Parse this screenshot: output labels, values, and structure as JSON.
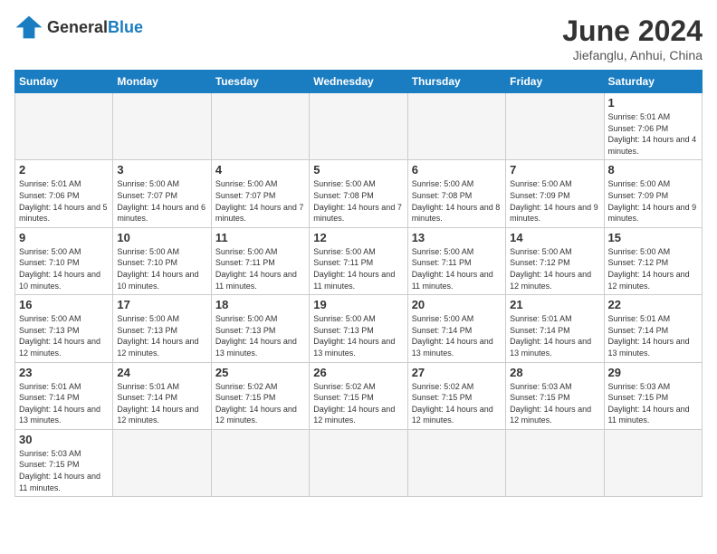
{
  "header": {
    "logo_general": "General",
    "logo_blue": "Blue",
    "month": "June 2024",
    "location": "Jiefanglu, Anhui, China"
  },
  "days_of_week": [
    "Sunday",
    "Monday",
    "Tuesday",
    "Wednesday",
    "Thursday",
    "Friday",
    "Saturday"
  ],
  "weeks": [
    [
      {
        "day": "",
        "info": ""
      },
      {
        "day": "",
        "info": ""
      },
      {
        "day": "",
        "info": ""
      },
      {
        "day": "",
        "info": ""
      },
      {
        "day": "",
        "info": ""
      },
      {
        "day": "",
        "info": ""
      },
      {
        "day": "1",
        "info": "Sunrise: 5:01 AM\nSunset: 7:06 PM\nDaylight: 14 hours and 4 minutes."
      }
    ],
    [
      {
        "day": "2",
        "info": "Sunrise: 5:01 AM\nSunset: 7:06 PM\nDaylight: 14 hours and 5 minutes."
      },
      {
        "day": "3",
        "info": "Sunrise: 5:00 AM\nSunset: 7:07 PM\nDaylight: 14 hours and 6 minutes."
      },
      {
        "day": "4",
        "info": "Sunrise: 5:00 AM\nSunset: 7:07 PM\nDaylight: 14 hours and 7 minutes."
      },
      {
        "day": "5",
        "info": "Sunrise: 5:00 AM\nSunset: 7:08 PM\nDaylight: 14 hours and 7 minutes."
      },
      {
        "day": "6",
        "info": "Sunrise: 5:00 AM\nSunset: 7:08 PM\nDaylight: 14 hours and 8 minutes."
      },
      {
        "day": "7",
        "info": "Sunrise: 5:00 AM\nSunset: 7:09 PM\nDaylight: 14 hours and 9 minutes."
      },
      {
        "day": "8",
        "info": "Sunrise: 5:00 AM\nSunset: 7:09 PM\nDaylight: 14 hours and 9 minutes."
      }
    ],
    [
      {
        "day": "9",
        "info": "Sunrise: 5:00 AM\nSunset: 7:10 PM\nDaylight: 14 hours and 10 minutes."
      },
      {
        "day": "10",
        "info": "Sunrise: 5:00 AM\nSunset: 7:10 PM\nDaylight: 14 hours and 10 minutes."
      },
      {
        "day": "11",
        "info": "Sunrise: 5:00 AM\nSunset: 7:11 PM\nDaylight: 14 hours and 11 minutes."
      },
      {
        "day": "12",
        "info": "Sunrise: 5:00 AM\nSunset: 7:11 PM\nDaylight: 14 hours and 11 minutes."
      },
      {
        "day": "13",
        "info": "Sunrise: 5:00 AM\nSunset: 7:11 PM\nDaylight: 14 hours and 11 minutes."
      },
      {
        "day": "14",
        "info": "Sunrise: 5:00 AM\nSunset: 7:12 PM\nDaylight: 14 hours and 12 minutes."
      },
      {
        "day": "15",
        "info": "Sunrise: 5:00 AM\nSunset: 7:12 PM\nDaylight: 14 hours and 12 minutes."
      }
    ],
    [
      {
        "day": "16",
        "info": "Sunrise: 5:00 AM\nSunset: 7:13 PM\nDaylight: 14 hours and 12 minutes."
      },
      {
        "day": "17",
        "info": "Sunrise: 5:00 AM\nSunset: 7:13 PM\nDaylight: 14 hours and 12 minutes."
      },
      {
        "day": "18",
        "info": "Sunrise: 5:00 AM\nSunset: 7:13 PM\nDaylight: 14 hours and 13 minutes."
      },
      {
        "day": "19",
        "info": "Sunrise: 5:00 AM\nSunset: 7:13 PM\nDaylight: 14 hours and 13 minutes."
      },
      {
        "day": "20",
        "info": "Sunrise: 5:00 AM\nSunset: 7:14 PM\nDaylight: 14 hours and 13 minutes."
      },
      {
        "day": "21",
        "info": "Sunrise: 5:01 AM\nSunset: 7:14 PM\nDaylight: 14 hours and 13 minutes."
      },
      {
        "day": "22",
        "info": "Sunrise: 5:01 AM\nSunset: 7:14 PM\nDaylight: 14 hours and 13 minutes."
      }
    ],
    [
      {
        "day": "23",
        "info": "Sunrise: 5:01 AM\nSunset: 7:14 PM\nDaylight: 14 hours and 13 minutes."
      },
      {
        "day": "24",
        "info": "Sunrise: 5:01 AM\nSunset: 7:14 PM\nDaylight: 14 hours and 12 minutes."
      },
      {
        "day": "25",
        "info": "Sunrise: 5:02 AM\nSunset: 7:15 PM\nDaylight: 14 hours and 12 minutes."
      },
      {
        "day": "26",
        "info": "Sunrise: 5:02 AM\nSunset: 7:15 PM\nDaylight: 14 hours and 12 minutes."
      },
      {
        "day": "27",
        "info": "Sunrise: 5:02 AM\nSunset: 7:15 PM\nDaylight: 14 hours and 12 minutes."
      },
      {
        "day": "28",
        "info": "Sunrise: 5:03 AM\nSunset: 7:15 PM\nDaylight: 14 hours and 12 minutes."
      },
      {
        "day": "29",
        "info": "Sunrise: 5:03 AM\nSunset: 7:15 PM\nDaylight: 14 hours and 11 minutes."
      }
    ],
    [
      {
        "day": "30",
        "info": "Sunrise: 5:03 AM\nSunset: 7:15 PM\nDaylight: 14 hours and 11 minutes."
      },
      {
        "day": "",
        "info": ""
      },
      {
        "day": "",
        "info": ""
      },
      {
        "day": "",
        "info": ""
      },
      {
        "day": "",
        "info": ""
      },
      {
        "day": "",
        "info": ""
      },
      {
        "day": "",
        "info": ""
      }
    ]
  ]
}
